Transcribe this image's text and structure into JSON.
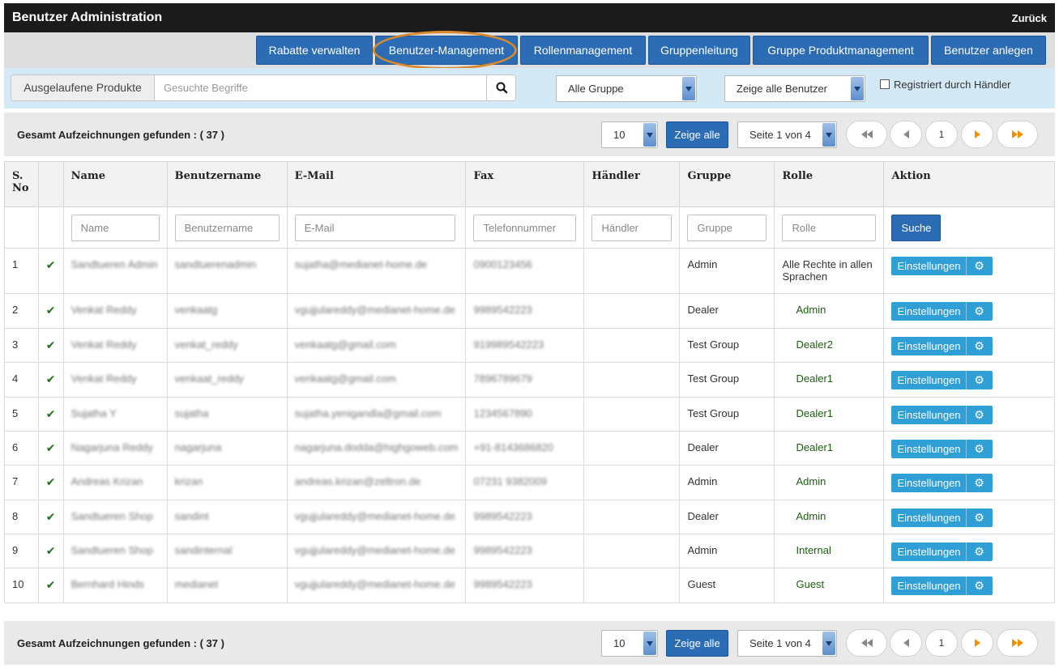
{
  "header": {
    "title": "Benutzer Administration",
    "back_label": "Zurück"
  },
  "nav": {
    "buttons": [
      {
        "label": "Rabatte verwalten"
      },
      {
        "label": "Benutzer-Management",
        "active": true
      },
      {
        "label": "Rollenmanagement"
      },
      {
        "label": "Gruppenleitung"
      },
      {
        "label": "Gruppe Produktmanagement"
      },
      {
        "label": "Benutzer anlegen"
      }
    ],
    "highlight_color": "#d9892b"
  },
  "filters": {
    "addon_label": "Ausgelaufene Produkte",
    "search_placeholder": "Gesuchte Begriffe",
    "group_select": "Alle Gruppe",
    "user_select": "Zeige alle Benutzer",
    "checkbox_label": "Registriert durch Händler",
    "checkbox_checked": false
  },
  "pager": {
    "total_label": "Gesamt Aufzeichnungen gefunden : ( 37 )",
    "page_size": "10",
    "show_all_label": "Zeige alle",
    "page_select": "Seite 1 von 4",
    "current_page": "1"
  },
  "table": {
    "headers": {
      "sno_1": "S.",
      "sno_2": "No",
      "name": "Name",
      "username": "Benutzername",
      "email": "E-Mail",
      "fax": "Fax",
      "dealer": "Händler",
      "group": "Gruppe",
      "role": "Rolle",
      "action": "Aktion"
    },
    "filter_placeholders": {
      "name": "Name",
      "username": "Benutzername",
      "email": "E-Mail",
      "fax": "Telefonnummer",
      "dealer": "Händler",
      "group": "Gruppe",
      "role": "Rolle"
    },
    "search_label": "Suche",
    "settings_label": "Einstellungen",
    "check_glyph": "✔",
    "rows": [
      {
        "no": "1",
        "name": "Sandtueren Admin",
        "username": "sandtuerenadmin",
        "email": "sujatha@medianet-home.de",
        "fax": "0900123456",
        "group": "Admin",
        "role": "Alle Rechte in allen Sprachen",
        "indent": false
      },
      {
        "no": "2",
        "name": "Venkat Reddy",
        "username": "venkaatg",
        "email": "vgujjulareddy@medianet-home.de",
        "fax": "9989542223",
        "group": "Dealer",
        "role": "Admin",
        "indent": true
      },
      {
        "no": "3",
        "name": "Venkat Reddy",
        "username": "venkat_reddy",
        "email": "venkaatg@gmail.com",
        "fax": "919989542223",
        "group": "Test Group",
        "role": "Dealer2",
        "indent": true
      },
      {
        "no": "4",
        "name": "Venkat Reddy",
        "username": "venkaat_reddy",
        "email": "venkaatg@gmail.com",
        "fax": "7896789679",
        "group": "Test Group",
        "role": "Dealer1",
        "indent": true
      },
      {
        "no": "5",
        "name": "Sujatha Y",
        "username": "sujatha",
        "email": "sujatha.yenigandla@gmail.com",
        "fax": "1234567890",
        "group": "Test Group",
        "role": "Dealer1",
        "indent": true
      },
      {
        "no": "6",
        "name": "Nagarjuna Reddy",
        "username": "nagarjuna",
        "email": "nagarjuna.dodda@highgoweb.com",
        "fax": "+91-8143686820",
        "group": "Dealer",
        "role": "Dealer1",
        "indent": true
      },
      {
        "no": "7",
        "name": "Andreas Krizan",
        "username": "krizan",
        "email": "andreas.krizan@zeltron.de",
        "fax": "07231 9382009",
        "group": "Admin",
        "role": "Admin",
        "indent": true
      },
      {
        "no": "8",
        "name": "Sandtueren Shop",
        "username": "sandint",
        "email": "vgujjulareddy@medianet-home.de",
        "fax": "9989542223",
        "group": "Dealer",
        "role": "Admin",
        "indent": true
      },
      {
        "no": "9",
        "name": "Sandtueren Shop",
        "username": "sandinternal",
        "email": "vgujjulareddy@medianet-home.de",
        "fax": "9989542223",
        "group": "Admin",
        "role": "Internal",
        "indent": true
      },
      {
        "no": "10",
        "name": "Bernhard Hinds",
        "username": "medianet",
        "email": "vgujjulareddy@medianet-home.de",
        "fax": "9989542223",
        "group": "Guest",
        "role": "Guest",
        "indent": true
      }
    ]
  },
  "colors": {
    "primary": "#2b6cb5",
    "settings": "#2f9fd6",
    "check": "#1f6f1f",
    "page_arrow": "#f29100"
  }
}
